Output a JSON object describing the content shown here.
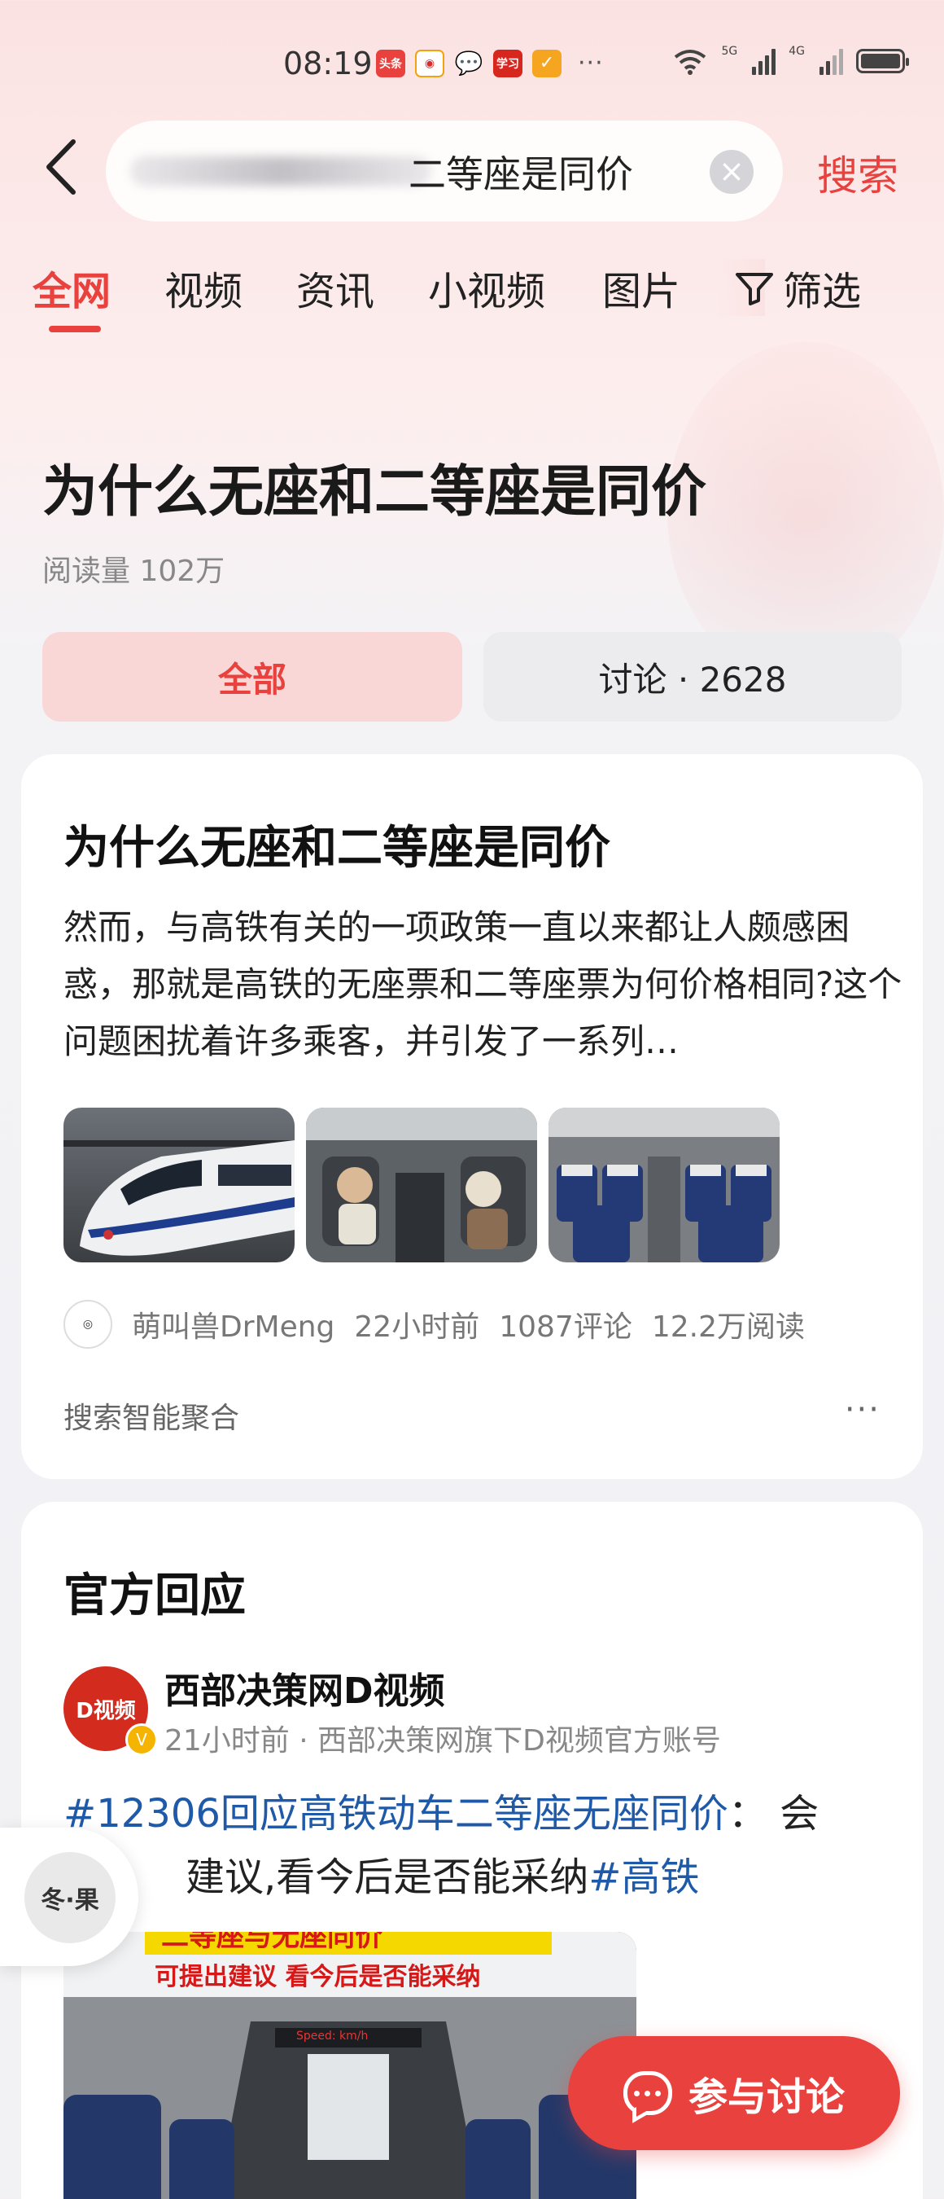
{
  "status_bar": {
    "time": "08:19",
    "app_icons": [
      {
        "name": "toutiao-icon",
        "label": "头条",
        "color": "#e8413e"
      },
      {
        "name": "weibo-icon",
        "label": "",
        "color": "#f2a20c"
      },
      {
        "name": "wechat-icon",
        "label": "",
        "color": "#9a9a9a"
      },
      {
        "name": "study-icon",
        "label": "学习",
        "color": "#d7261e"
      },
      {
        "name": "app-icon",
        "label": "",
        "color": "#f6a521"
      }
    ],
    "more": "···",
    "signal1_label": "5G",
    "signal2_label": "4G"
  },
  "search": {
    "query_visible": "二等座是同价",
    "button": "搜索"
  },
  "tabs": [
    "全网",
    "视频",
    "资讯",
    "小视频",
    "图片"
  ],
  "filter_label": "筛选",
  "topic": {
    "title": "为什么无座和二等座是同价",
    "read_count": "阅读量 102万"
  },
  "segments": {
    "all": "全部",
    "discussion": "讨论 · 2628"
  },
  "card1": {
    "title": "为什么无座和二等座是同价",
    "body": "然而，与高铁有关的一项政策一直以来都让人颇感困惑，那就是高铁的无座票和二等座票为何价格相同?这个问题困扰着许多乘客，并引发了一系列…",
    "author": "萌叫兽DrMeng",
    "time": "22小时前",
    "comments": "1087评论",
    "reads": "12.2万阅读",
    "footer": "搜索智能聚合",
    "more": "···"
  },
  "card2": {
    "title": "官方回应",
    "account_avatar_text": "D视频",
    "account_name": "西部决策网D视频",
    "account_sub": "21小时前 · 西部决策网旗下D视频官方账号",
    "hashtag1": "#12306回应高铁动车二等座无座同价",
    "text": "： 会",
    "line2_text": "建议,看今后是否能采纳",
    "hashtag2": "#高铁",
    "video_caption1": "二等座与无座同价",
    "video_caption2": "可提出建议 看今后是否能采纳",
    "video_speed": "Speed:    km/h"
  },
  "float_badge": "冬·果",
  "discuss_button": "参与讨论"
}
